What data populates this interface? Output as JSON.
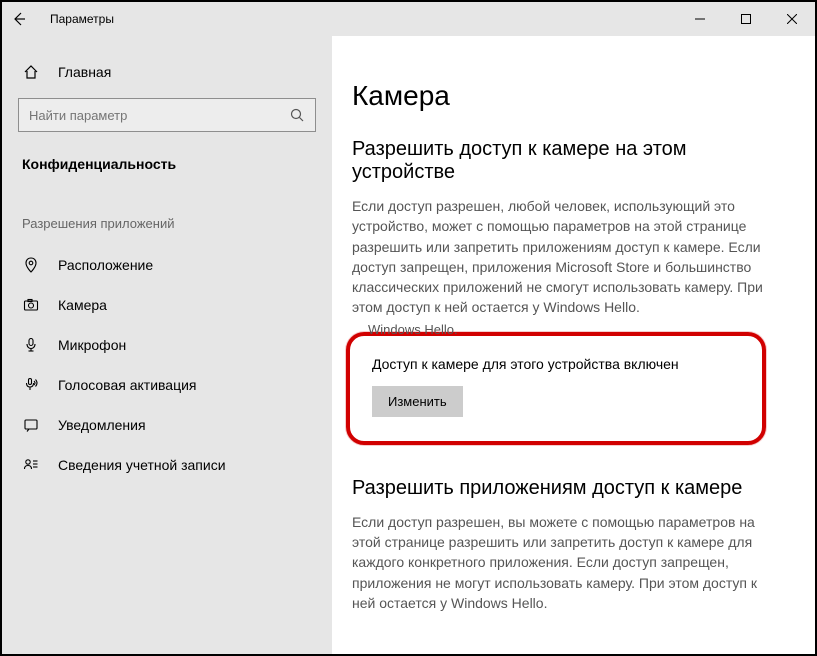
{
  "titlebar": {
    "app_title": "Параметры"
  },
  "sidebar": {
    "home_label": "Главная",
    "search_placeholder": "Найти параметр",
    "section_label": "Конфиденциальность",
    "group_label": "Разрешения приложений",
    "items": [
      {
        "label": "Расположение"
      },
      {
        "label": "Камера"
      },
      {
        "label": "Микрофон"
      },
      {
        "label": "Голосовая активация"
      },
      {
        "label": "Уведомления"
      },
      {
        "label": "Сведения учетной записи"
      }
    ]
  },
  "content": {
    "page_title": "Камера",
    "section1_title": "Разрешить доступ к камере на этом устройстве",
    "section1_body": "Если доступ разрешен, любой человек, использующий это устройство, может с помощью параметров на этой странице разрешить или запретить приложениям доступ к камере. Если доступ запрещен, приложения Microsoft Store и большинство классических приложений не смогут использовать камеру. При этом доступ к ней остается у Windows Hello.",
    "cutoff_text": "Windows Hello.",
    "status_line": "Доступ к камере для этого устройства включен",
    "change_button": "Изменить",
    "section2_title": "Разрешить приложениям доступ к камере",
    "section2_body": "Если доступ разрешен, вы можете с помощью параметров на этой странице разрешить или запретить доступ к камере для каждого конкретного приложения. Если доступ запрещен, приложения не могут использовать камеру. При этом доступ к ней остается у Windows Hello."
  }
}
